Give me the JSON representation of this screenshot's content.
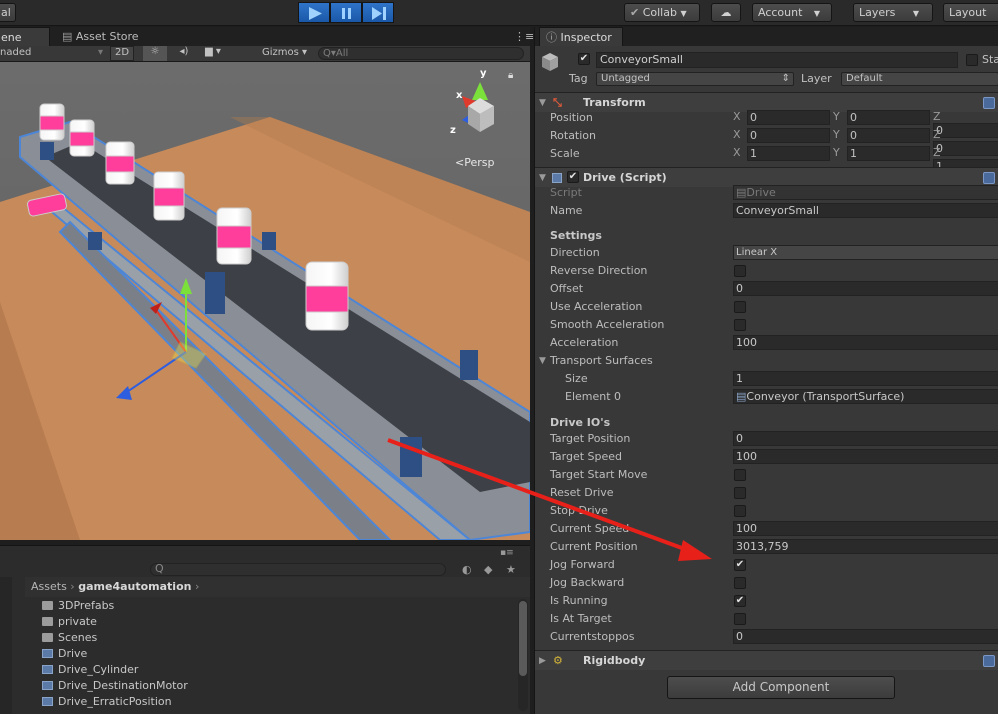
{
  "toolbar": {
    "left_cut": "al",
    "collab": "Collab",
    "account": "Account",
    "layers": "Layers",
    "layout": "Layout"
  },
  "scene_tabs": {
    "scene": "ene",
    "asset_store": "Asset Store"
  },
  "scene_toolbar": {
    "shading": "naded",
    "mode_2d": "2D",
    "gizmos": "Gizmos",
    "search_placeholder": "All"
  },
  "viewport": {
    "persp_label": "Persp",
    "axis_x": "x",
    "axis_y": "y",
    "axis_z": "z"
  },
  "project": {
    "breadcrumb_root": "Assets",
    "breadcrumb_current": "game4automation",
    "items": [
      {
        "label": "3DPrefabs",
        "icon": "folder-icon"
      },
      {
        "label": "private",
        "icon": "folder-icon"
      },
      {
        "label": "Scenes",
        "icon": "folder-icon"
      },
      {
        "label": "Drive",
        "icon": "script-icon"
      },
      {
        "label": "Drive_Cylinder",
        "icon": "script-icon"
      },
      {
        "label": "Drive_DestinationMotor",
        "icon": "script-icon"
      },
      {
        "label": "Drive_ErraticPosition",
        "icon": "script-icon"
      }
    ]
  },
  "inspector": {
    "tab": "Inspector",
    "object_name": "ConveyorSmall",
    "static_label": "Sta",
    "tag_label": "Tag",
    "tag_value": "Untagged",
    "layer_label": "Layer",
    "layer_value": "Default",
    "transform": {
      "title": "Transform",
      "position": {
        "label": "Position",
        "x": "0",
        "y": "0",
        "z": "0"
      },
      "rotation": {
        "label": "Rotation",
        "x": "0",
        "y": "0",
        "z": "0"
      },
      "scale": {
        "label": "Scale",
        "x": "1",
        "y": "1",
        "z": "1"
      }
    },
    "drive": {
      "title": "Drive (Script)",
      "script_label": "Script",
      "script_value": "Drive",
      "name_label": "Name",
      "name_value": "ConveyorSmall",
      "settings_header": "Settings",
      "direction_label": "Direction",
      "direction_value": "Linear X",
      "reverse_label": "Reverse Direction",
      "offset_label": "Offset",
      "offset_value": "0",
      "use_accel_label": "Use Acceleration",
      "smooth_accel_label": "Smooth Acceleration",
      "accel_label": "Acceleration",
      "accel_value": "100",
      "surfaces_label": "Transport Surfaces",
      "size_label": "Size",
      "size_value": "1",
      "element0_label": "Element 0",
      "element0_value": "Conveyor (TransportSurface)",
      "io_header": "Drive IO's",
      "target_pos_label": "Target Position",
      "target_pos_value": "0",
      "target_speed_label": "Target Speed",
      "target_speed_value": "100",
      "target_start_label": "Target Start Move",
      "reset_label": "Reset Drive",
      "stop_label": "Stop Drive",
      "current_speed_label": "Current Speed",
      "current_speed_value": "100",
      "current_pos_label": "Current Position",
      "current_pos_value": "3013,759",
      "jog_fwd_label": "Jog Forward",
      "jog_back_label": "Jog Backward",
      "running_label": "Is Running",
      "at_target_label": "Is At Target",
      "stoppos_label": "Currentstoppos",
      "stoppos_value": "0"
    },
    "rigidbody_title": "Rigidbody",
    "add_component": "Add Component"
  },
  "colors": {
    "play_blue": "#2a6cc0",
    "arrow_red": "#e8201a",
    "panel": "#383838"
  }
}
